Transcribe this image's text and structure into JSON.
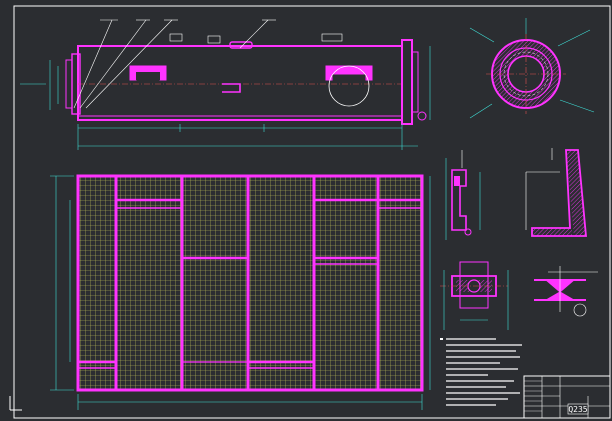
{
  "title_block": {
    "drawing_code": "Q235"
  },
  "colors": {
    "background": "#000000",
    "viewport": "#2b2d31",
    "frame": "#ffffff",
    "part": "#ff33ff",
    "hatch": "#c8c85a",
    "dimension": "#3fe0d8",
    "leader": "#ffffff",
    "center_line": "#e05050"
  },
  "icons": [
    "ucs-icon"
  ]
}
